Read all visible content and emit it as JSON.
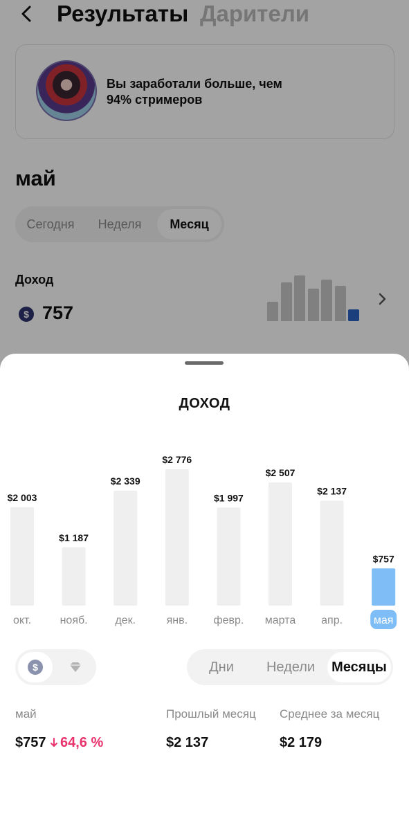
{
  "header": {
    "tab_results": "Результаты",
    "tab_donors": "Дарители"
  },
  "promo": {
    "text_line1": "Вы заработали больше, чем",
    "text_line2": "94% стримеров"
  },
  "summary": {
    "month": "май",
    "periods": [
      "Сегодня",
      "Неделя",
      "Месяц"
    ],
    "selected_period": "Месяц",
    "income_label": "Доход",
    "currency_icon": "$",
    "income_value": "757",
    "trend_values": [
      1187,
      2339,
      2776,
      1997,
      2507,
      2137,
      757
    ]
  },
  "sheet": {
    "title": "ДОХОД",
    "currency_icons": [
      "dollar-coin-icon",
      "diamond-icon"
    ],
    "ranges": [
      "Дни",
      "Недели",
      "Месяцы"
    ],
    "selected_range": "Месяцы",
    "stats": {
      "current_label": "май",
      "current_value": "$757",
      "change": "64,6 %",
      "change_direction": "down",
      "prev_label": "Прошлый месяц",
      "prev_value": "$2 137",
      "avg_label": "Среднее за месяц",
      "avg_value": "$2 179"
    }
  },
  "colors": {
    "accent_blue": "#7ebdf5",
    "selected_label_bg": "#7ebdf5",
    "bar_gray": "#efefef",
    "negative": "#e8336d"
  },
  "chart_data": {
    "type": "bar",
    "title": "ДОХОД",
    "categories": [
      "окт.",
      "нояб.",
      "дек.",
      "янв.",
      "февр.",
      "марта",
      "апр.",
      "мая"
    ],
    "values": [
      2003,
      1187,
      2339,
      2776,
      1997,
      2507,
      2137,
      757
    ],
    "value_labels": [
      "$2 003",
      "$1 187",
      "$2 339",
      "$2 776",
      "$1 997",
      "$2 507",
      "$2 137",
      "$757"
    ],
    "highlight_index": 7,
    "grid": false
  }
}
